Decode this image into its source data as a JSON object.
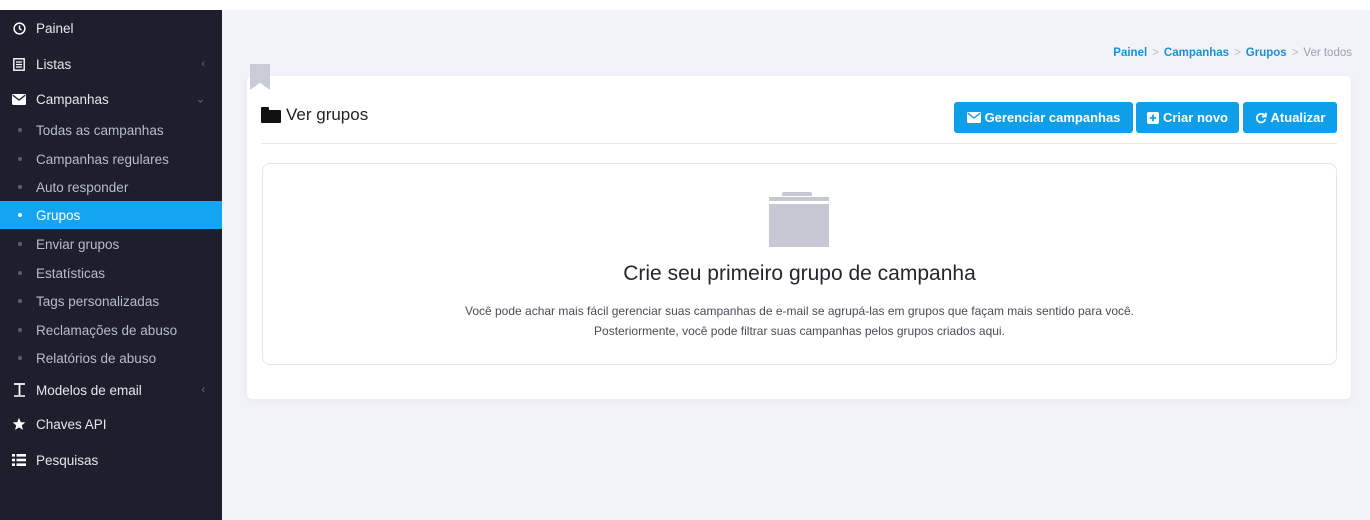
{
  "colors": {
    "accent": "#14a5f2",
    "sidebar_bg": "#1d1f2c",
    "page_bg": "#f2f3f8",
    "button": "#0f9ee8",
    "empty_icon": "#c5c7d3"
  },
  "sidebar": {
    "items": [
      {
        "label": "Painel",
        "icon": "clock-icon",
        "chevron": ""
      },
      {
        "label": "Listas",
        "icon": "list-alt-icon",
        "chevron": "‹"
      },
      {
        "label": "Campanhas",
        "icon": "envelope-icon",
        "chevron": "⌄"
      },
      {
        "label": "Modelos de email",
        "icon": "text-t-icon",
        "chevron": "‹"
      },
      {
        "label": "Chaves API",
        "icon": "star-icon",
        "chevron": ""
      },
      {
        "label": "Pesquisas",
        "icon": "list-icon",
        "chevron": ""
      }
    ],
    "campaign_subitems": [
      "Todas as campanhas",
      "Campanhas regulares",
      "Auto responder",
      "Grupos",
      "Enviar grupos",
      "Estatísticas",
      "Tags personalizadas",
      "Reclamações de abuso",
      "Relatórios de abuso"
    ],
    "active_subitem": "Grupos"
  },
  "breadcrumb": {
    "items": [
      "Painel",
      "Campanhas",
      "Grupos"
    ],
    "current": "Ver todos",
    "separator": ">"
  },
  "panel": {
    "title": "Ver grupos",
    "title_icon": "folder-icon",
    "buttons": {
      "manage": "Gerenciar campanhas",
      "new": "Criar novo",
      "refresh": "Atualizar"
    }
  },
  "empty_state": {
    "icon": "folder-icon",
    "title": "Crie seu primeiro grupo de campanha",
    "line1": "Você pode achar mais fácil gerenciar suas campanhas de e-mail se agrupá-las em grupos que façam mais sentido para você.",
    "line2": "Posteriormente, você pode filtrar suas campanhas pelos grupos criados aqui."
  }
}
